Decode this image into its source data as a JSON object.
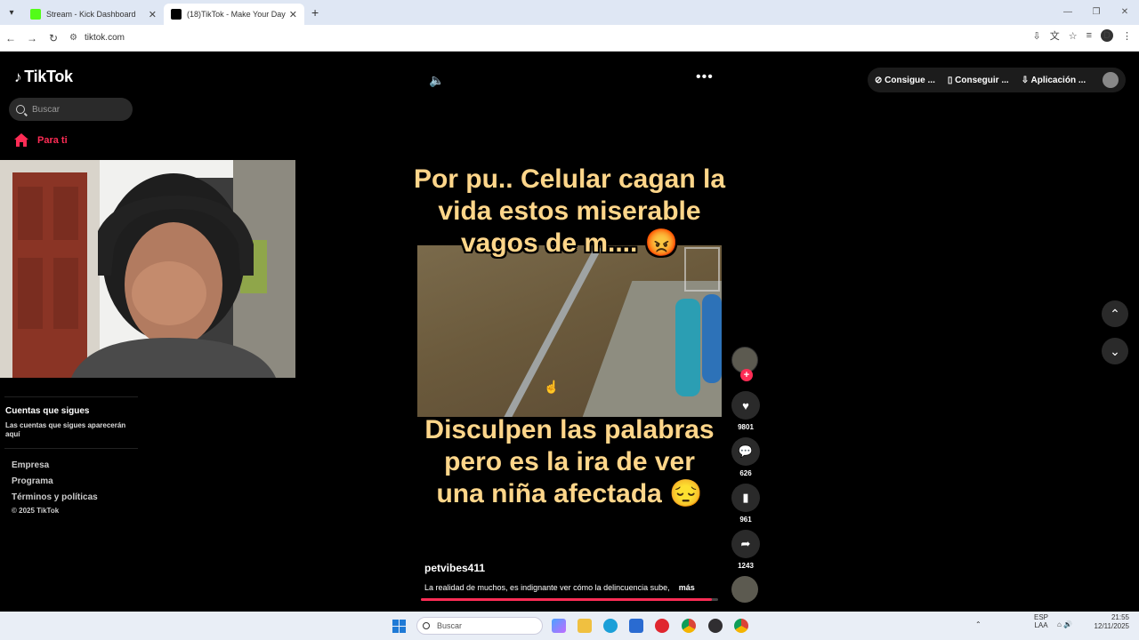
{
  "browser": {
    "tabs": [
      {
        "title": "Stream - Kick Dashboard",
        "active": false,
        "favicon_color": "#53fc18"
      },
      {
        "title": "(18)TikTok - Make Your Day",
        "active": true,
        "favicon_color": "#000000"
      }
    ],
    "url": "tiktok.com"
  },
  "tiktok": {
    "logo": "TikTok",
    "search_placeholder": "Buscar",
    "nav_for_you": "Para ti",
    "following_title": "Cuentas que sigues",
    "following_sub": "Las cuentas que sigues aparecerán aquí",
    "footer": {
      "company": "Empresa",
      "program": "Programa",
      "terms": "Términos y políticas",
      "copyright": "© 2025 TikTok"
    },
    "topbar": {
      "coins": "Consigue ...",
      "get_app": "Conseguir ...",
      "desktop_app": "Aplicación ..."
    },
    "video": {
      "caption_top": "Por pu.. Celular cagan la vida estos miserable vagos de m.... 😡",
      "caption_bottom": "Disculpen las palabras pero es la ira de ver una niña afectada 😔",
      "username": "petvibes411",
      "description": "La realidad de muchos, es indignante ver cómo la delincuencia sube,",
      "more": "más",
      "progress": 0.98,
      "likes": "9801",
      "comments": "626",
      "saves": "961",
      "shares": "1243"
    }
  },
  "taskbar": {
    "search_placeholder": "Buscar",
    "lang": "ESP",
    "lang2": "LAA",
    "time": "21:55",
    "date": "12/11/2025"
  }
}
